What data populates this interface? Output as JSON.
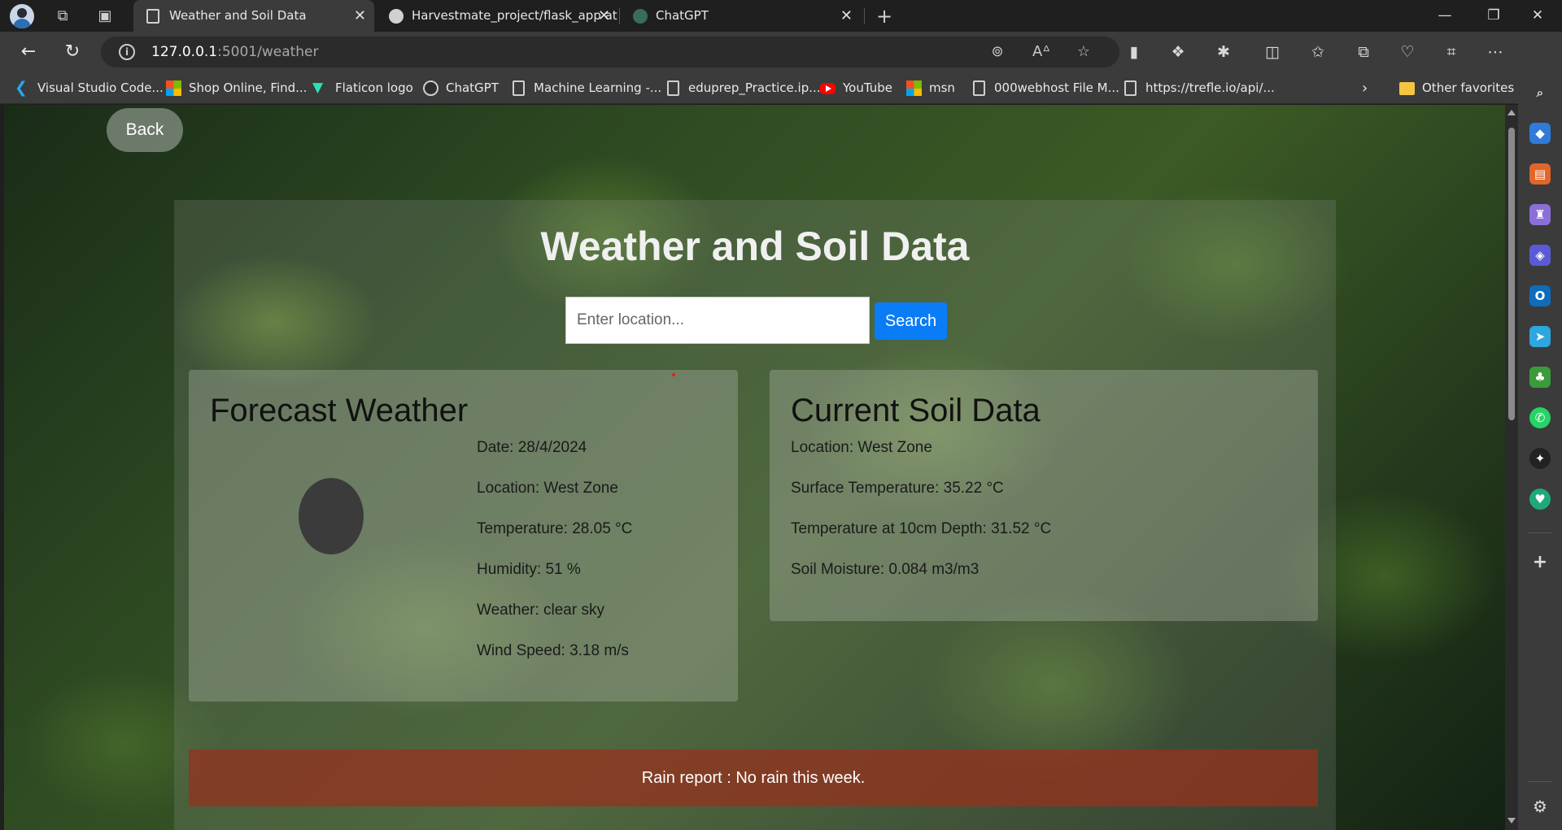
{
  "browser": {
    "tabs": [
      {
        "title": "Weather and Soil Data",
        "active": true
      },
      {
        "title": "Harvestmate_project/flask_app at",
        "active": false
      },
      {
        "title": "ChatGPT",
        "active": false
      }
    ],
    "url_host": "127.0.0.1",
    "url_rest": ":5001/weather",
    "favorites": [
      {
        "label": "Visual Studio Code...",
        "icon": "vscode-icon"
      },
      {
        "label": "Shop Online, Find...",
        "icon": "microsoft-icon"
      },
      {
        "label": "Flaticon logo",
        "icon": "flaticon-icon"
      },
      {
        "label": "ChatGPT",
        "icon": "chatgpt-icon"
      },
      {
        "label": "Machine Learning -...",
        "icon": "document-icon"
      },
      {
        "label": "eduprep_Practice.ip...",
        "icon": "document-icon"
      },
      {
        "label": "YouTube",
        "icon": "youtube-icon"
      },
      {
        "label": "msn",
        "icon": "microsoft-icon"
      },
      {
        "label": "000webhost File M...",
        "icon": "document-icon"
      },
      {
        "label": "https://trefle.io/api/...",
        "icon": "document-icon"
      }
    ],
    "other_favorites": "Other favorites"
  },
  "page": {
    "back_label": "Back",
    "title": "Weather and Soil Data",
    "search_placeholder": "Enter location...",
    "search_label": "Search",
    "weather": {
      "heading": "Forecast Weather",
      "date": "Date: 28/4/2024",
      "location": "Location: West Zone",
      "temperature": "Temperature: 28.05 °C",
      "humidity": "Humidity: 51 %",
      "condition": "Weather: clear sky",
      "wind": "Wind Speed: 3.18 m/s"
    },
    "soil": {
      "heading": "Current Soil Data",
      "location": "Location: West Zone",
      "surface_temp": "Surface Temperature: 35.22 °C",
      "depth_temp": "Temperature at 10cm Depth: 31.52 °C",
      "moisture": "Soil Moisture: 0.084 m3/m3"
    },
    "rain_report": "Rain report : No rain this week."
  },
  "colors": {
    "search_button": "#0a7cf5",
    "rain_banner": "#96321e",
    "browser_chrome": "#3b3b3b"
  }
}
